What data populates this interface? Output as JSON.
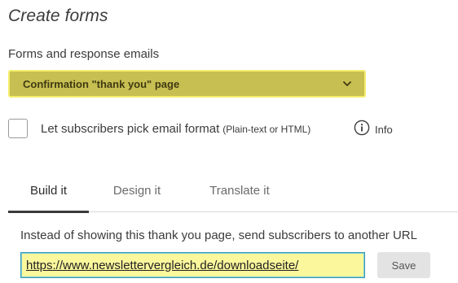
{
  "header": {
    "title": "Create forms"
  },
  "forms_section": {
    "label": "Forms and response emails",
    "selected_form": "Confirmation \"thank you\" page"
  },
  "email_format": {
    "checked": false,
    "label": "Let subscribers pick email format",
    "sublabel": "(Plain-text or HTML)",
    "info_label": "Info"
  },
  "tabs": [
    {
      "label": "Build it",
      "active": true
    },
    {
      "label": "Design it",
      "active": false
    },
    {
      "label": "Translate it",
      "active": false
    }
  ],
  "redirect": {
    "label": "Instead of showing this thank you page, send subscribers to another URL",
    "url_value": "https://www.newslettervergleich.de/downloadseite/",
    "save_label": "Save"
  },
  "colors": {
    "select_bg": "#c8bf52",
    "select_highlight": "#f4ee6e",
    "input_bg": "#fbf79c",
    "input_border": "#3a9bb0",
    "save_bg": "#e3e3e3"
  }
}
